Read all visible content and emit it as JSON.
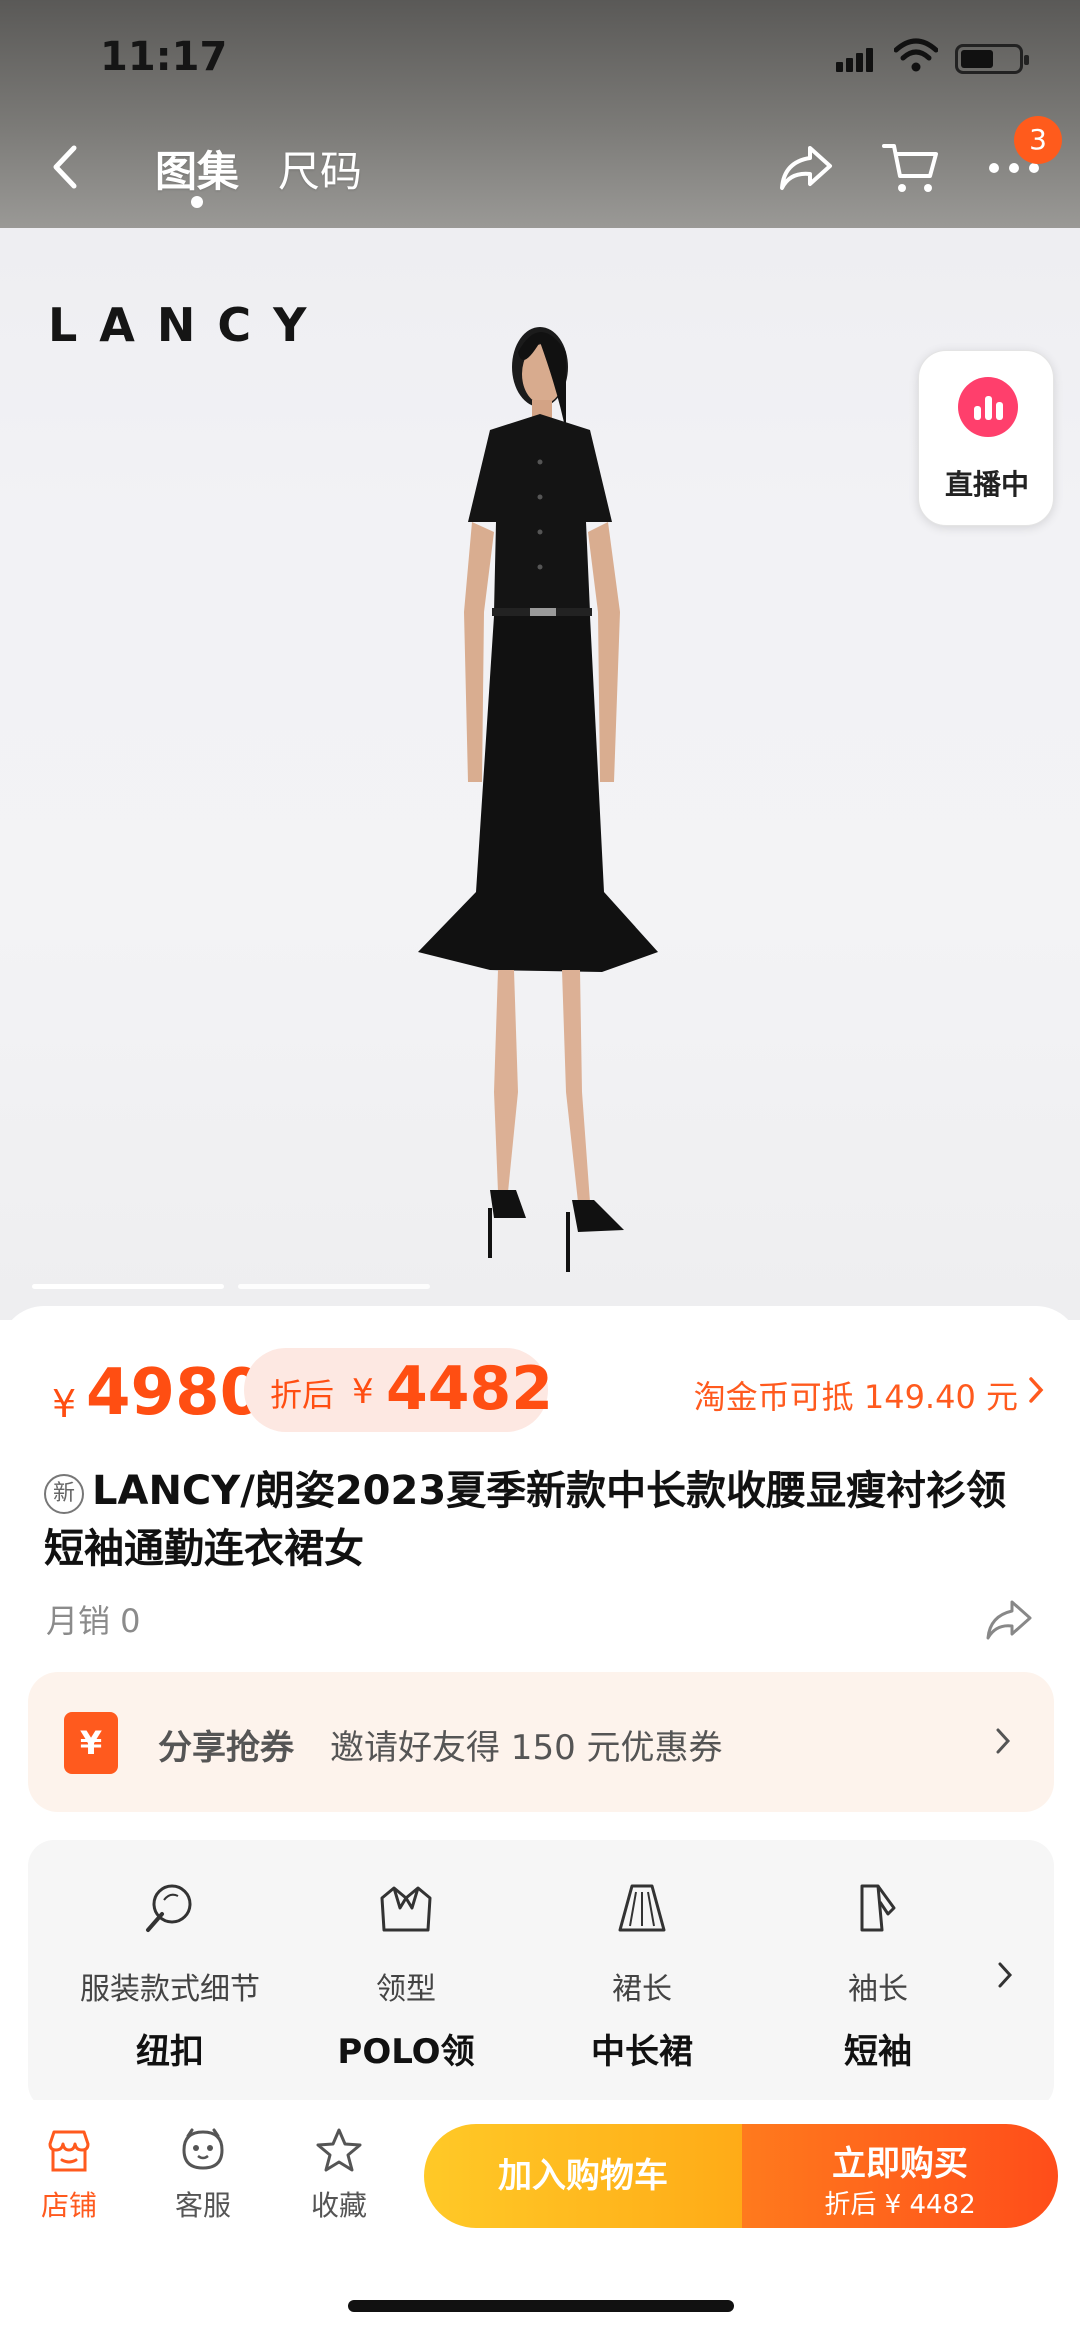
{
  "status": {
    "time": "11:17"
  },
  "nav": {
    "tabs": [
      "图集",
      "尺码"
    ],
    "cart_badge": "3",
    "icons": [
      "back-icon",
      "share-icon",
      "cart-icon",
      "more-icon"
    ]
  },
  "hero": {
    "brand": "LANCY",
    "live_label": "直播中",
    "page_count": 2,
    "active_page": 1
  },
  "price": {
    "yen": "¥",
    "main": "4980",
    "discount_label": "折后",
    "discount_yen": "¥",
    "discount_price": "4482",
    "coin_text": "淘金币可抵 149.40 元"
  },
  "product": {
    "new_tag": "新",
    "title": "LANCY/朗姿2023夏季新款中长款收腰显瘦衬衫领短袖通勤连衣裙女",
    "sales": "月销 0"
  },
  "coupon": {
    "icon": "¥",
    "title": "分享抢券",
    "desc": "邀请好友得 150 元优惠券"
  },
  "attributes": [
    {
      "label": "服装款式细节",
      "value": "纽扣",
      "icon": "button-detail-icon"
    },
    {
      "label": "领型",
      "value": "POLO领",
      "icon": "collar-icon"
    },
    {
      "label": "裙长",
      "value": "中长裙",
      "icon": "skirt-icon"
    },
    {
      "label": "袖长",
      "value": "短袖",
      "icon": "sleeve-icon"
    }
  ],
  "bottom_bar": {
    "store": "店铺",
    "service": "客服",
    "favorite": "收藏",
    "add_cart": "加入购物车",
    "buy_now": "立即购买",
    "buy_sub": "折后 ¥ 4482"
  },
  "colors": {
    "accent": "#ff4e12",
    "cart_button": "#ffb31f",
    "buy_button": "#ff5a1a",
    "live": "#ff3f6c"
  }
}
